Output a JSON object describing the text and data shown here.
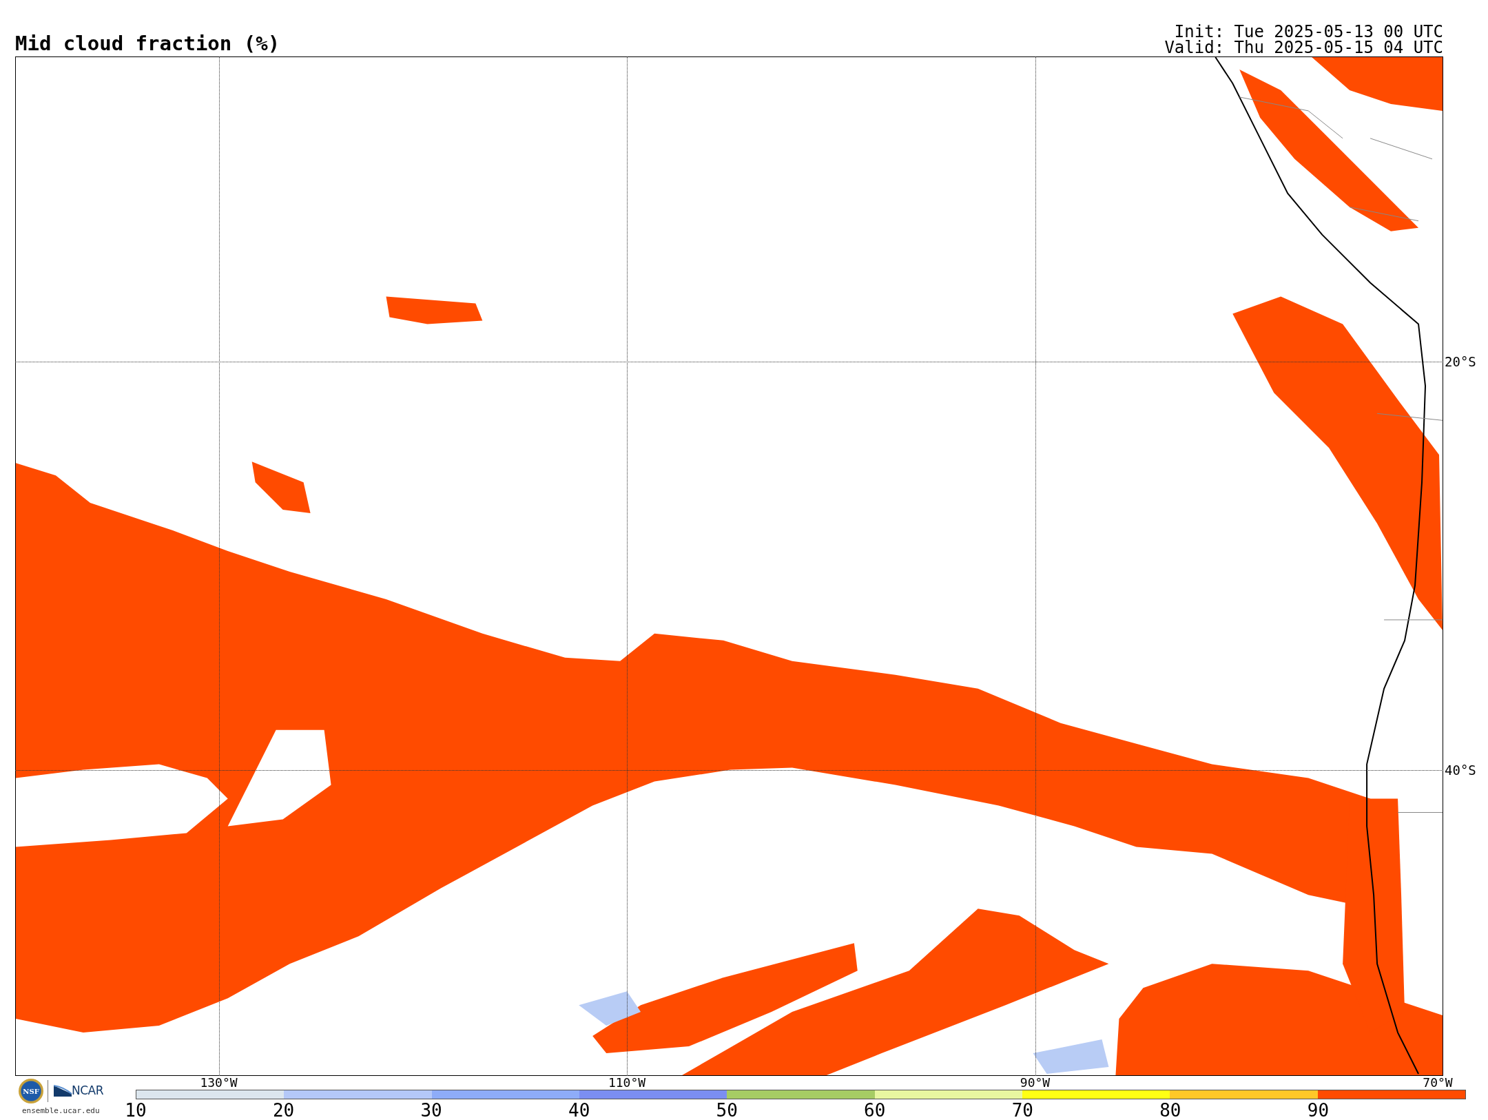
{
  "title": "Mid cloud fraction (%)",
  "init": "Init: Tue 2025-05-13 00 UTC",
  "valid": "Valid: Thu 2025-05-15 04 UTC",
  "map": {
    "lon_labels": [
      "130°W",
      "110°W",
      "90°W",
      "70°W"
    ],
    "lat_labels": [
      "20°S",
      "40°S"
    ]
  },
  "logos": {
    "nsf": "NSF",
    "ncar": "NCAR",
    "url": "ensemble.ucar.edu"
  },
  "colorbar": {
    "bins": [
      {
        "color": "#dce6ee"
      },
      {
        "color": "#b4c8f8"
      },
      {
        "color": "#8eacf8"
      },
      {
        "color": "#7b8ef2"
      },
      {
        "color": "#a6cc64"
      },
      {
        "color": "#e8f6a0"
      },
      {
        "color": "#ffff14"
      },
      {
        "color": "#ffc828"
      },
      {
        "color": "#ff4b00"
      }
    ],
    "labels": [
      "10",
      "20",
      "30",
      "40",
      "50",
      "60",
      "70",
      "80",
      "90"
    ]
  }
}
